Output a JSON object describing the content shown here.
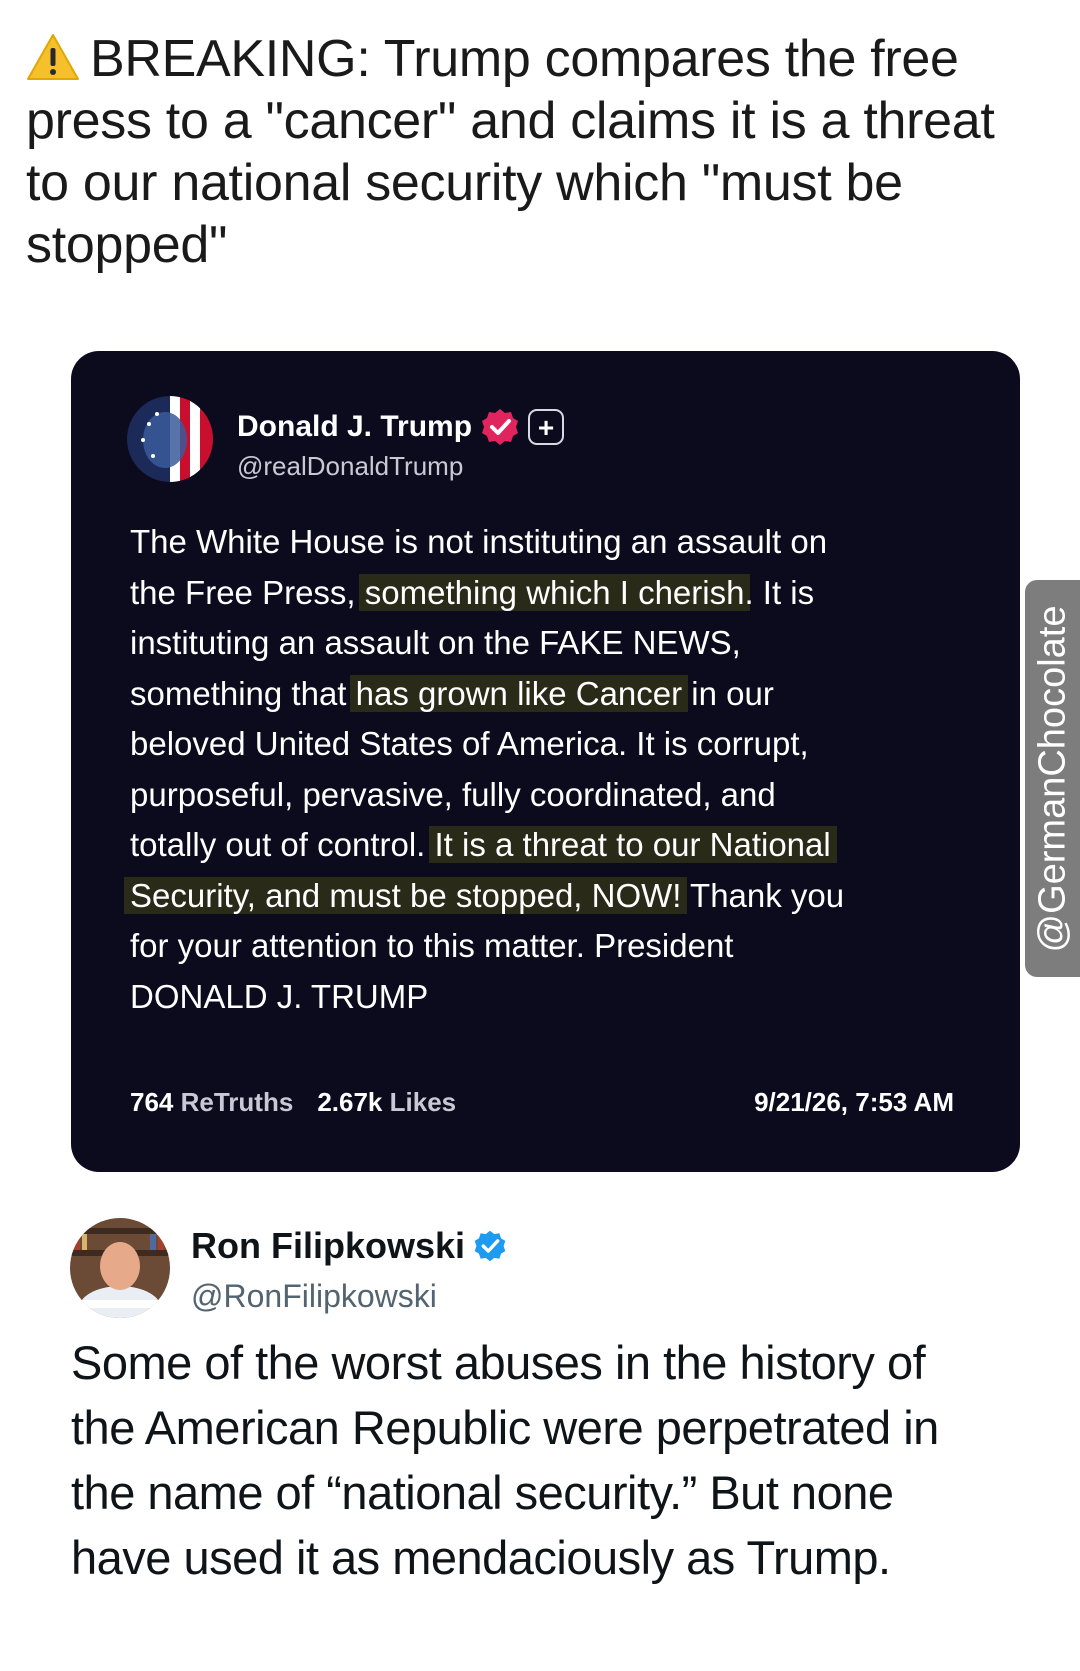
{
  "headline": {
    "icon": "warning-icon",
    "text": "BREAKING: Trump compares the free press to a \"cancer\" and claims it is a threat to our national security which \"must be stopped\""
  },
  "truth_post": {
    "author_name": "Donald J. Trump",
    "handle": "@realDonaldTrump",
    "verified_badge_color": "#e0245e",
    "plus_label": "+",
    "body_lines": [
      [
        {
          "t": "The White House is not instituting an assault on",
          "h": false
        }
      ],
      [
        {
          "t": "the Free Press, ",
          "h": false
        },
        {
          "t": "something which I cherish",
          "h": true
        },
        {
          "t": ". It is",
          "h": false
        }
      ],
      [
        {
          "t": "instituting an assault on the FAKE NEWS,",
          "h": false
        }
      ],
      [
        {
          "t": "something that ",
          "h": false
        },
        {
          "t": "has grown like Cancer",
          "h": true
        },
        {
          "t": " in our",
          "h": false
        }
      ],
      [
        {
          "t": "beloved United States of America. It is corrupt,",
          "h": false
        }
      ],
      [
        {
          "t": "purposeful, pervasive, fully coordinated, and",
          "h": false
        }
      ],
      [
        {
          "t": "totally out of control. ",
          "h": false
        },
        {
          "t": "It is a threat to our National",
          "h": true
        }
      ],
      [
        {
          "t": "Security, and must be stopped, NOW!",
          "h": true
        },
        {
          "t": " Thank you",
          "h": false
        }
      ],
      [
        {
          "t": "for your attention to this matter. President",
          "h": false
        }
      ],
      [
        {
          "t": "DONALD J. TRUMP",
          "h": false
        }
      ]
    ],
    "retruths_count": "764",
    "retruths_label": "ReTruths",
    "likes_count": "2.67k",
    "likes_label": "Likes",
    "timestamp": "9/21/26, 7:53 AM"
  },
  "watermark": "@GermanChocolate",
  "reply": {
    "author_name": "Ron Filipkowski",
    "handle": "@RonFilipkowski",
    "verified_badge_color": "#1d9bf0",
    "body_lines": [
      "Some of the worst abuses in the history of",
      "the American Republic were perpetrated in",
      "the name of “national security.” But none",
      "have used it as mendaciously as Trump."
    ]
  },
  "colors": {
    "card_background": "#0c0a1d",
    "highlight": "#2a2a18",
    "watermark_bg": "#7d7d7d"
  }
}
